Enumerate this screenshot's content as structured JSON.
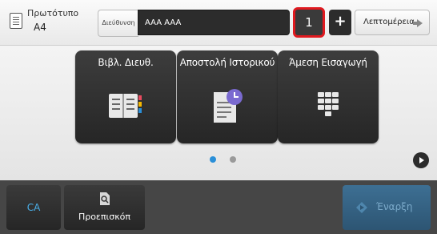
{
  "top_bar": {
    "original": {
      "line1": "Πρωτότυπο",
      "line2": "A4"
    },
    "destination_label": "Διεύθυνση",
    "destination_value": "AAA AAA",
    "copies": "1",
    "plus_label": "+",
    "details_label": "Λεπτομέρεια"
  },
  "tiles": [
    {
      "label": "Βιβλ. Διευθ.",
      "icon": "address-book-icon"
    },
    {
      "label": "Αποστολή Ιστορικού",
      "icon": "sending-history-icon"
    },
    {
      "label": "Άμεση Εισαγωγή",
      "icon": "keypad-icon"
    }
  ],
  "pagination": {
    "total": 2,
    "current": 1,
    "active_color": "#2a8fd8",
    "inactive_color": "#9a9a9a"
  },
  "bottom_bar": {
    "ca_label": "CA",
    "preview_label": "Προεπισκόπ",
    "start_label": "Έναρξη"
  },
  "colors": {
    "accent_red": "#e0191f",
    "ca_blue": "#4ab0ea",
    "start_blue": "#2d5573"
  }
}
